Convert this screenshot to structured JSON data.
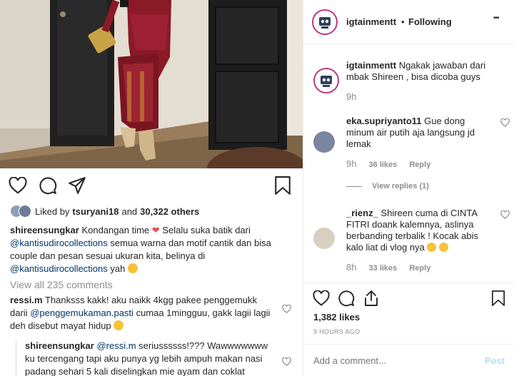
{
  "post": {
    "likes_prefix": "Liked by",
    "likes_user": "tsuryani18",
    "likes_and": "and",
    "likes_count": "30,322 others",
    "caption": {
      "user": "shireensungkar",
      "text1": "Kondangan time",
      "text2": "Selalu suka batik dari",
      "mention1": "@kantisudirocollections",
      "text3": "semua warna dan motif cantik  dan bisa couple dan pesan sesuai ukuran kita, belinya di",
      "mention2": "@kantisudirocollections",
      "text4": "yah"
    },
    "view_all": "View all 235 comments",
    "comments": [
      {
        "user": "ressi.m",
        "text1": "Thanksss kakk! aku naikk 4kgg pakee penggemukk darii",
        "mention": "@penggemukaman.pasti",
        "text2": "cumaa 1mingguu, gakk lagii lagii deh disebut mayat hidup"
      },
      {
        "user": "shireensungkar",
        "mention": "@ressi.m",
        "text": "seriussssss!??? Wawwwwwww ku tercengang tapi aku punya yg lebih ampuh makan nasi padang sehari 5 kali diselingkan mie ayam dan coklat insyaaAllah naik berat badan"
      }
    ]
  },
  "right": {
    "header": {
      "username": "igtainmentt",
      "separator": "•",
      "follow_status": "Following",
      "more": "•••"
    },
    "comments": [
      {
        "user": "igtainmentt",
        "text": "Ngakak jawaban dari mbak Shireen , bisa dicoba guys",
        "time": "9h"
      },
      {
        "user": "eka.supriyanto11",
        "text": "Gue dong minum air putih aja langsung jd lemak",
        "time": "9h",
        "likes": "36 likes",
        "reply": "Reply",
        "view_replies": "View replies (1)"
      },
      {
        "user": "_rienz_",
        "text": "Shireen cuma di CINTA FITRI doank kalemnya, aslinya berbanding terbalik ! Kocak abis kalo liat di vlog nya",
        "time": "8h",
        "likes": "33 likes",
        "reply": "Reply"
      }
    ],
    "likes": "1,382 likes",
    "date": "9 HOURS AGO",
    "add_comment_placeholder": "Add a comment...",
    "post_button": "Post"
  },
  "colors": {
    "text": "#262626",
    "muted": "#8e8e8e",
    "link": "#003569",
    "post_button": "#b2dffc",
    "heart_emoji": "#ed4956"
  },
  "icons": [
    "heart-icon",
    "comment-icon",
    "share-icon",
    "bookmark-icon",
    "more-icon"
  ]
}
